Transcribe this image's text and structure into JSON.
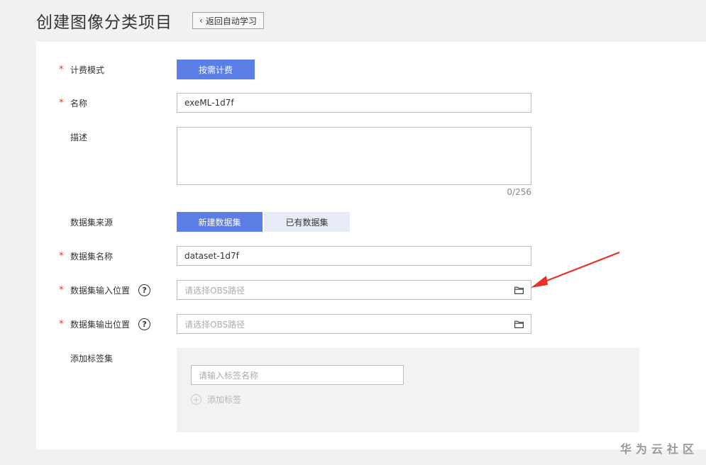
{
  "header": {
    "title": "创建图像分类项目",
    "back_label": "返回自动学习"
  },
  "form": {
    "billing": {
      "label": "计费模式",
      "value": "按需计费"
    },
    "name": {
      "label": "名称",
      "value": "exeML-1d7f"
    },
    "description": {
      "label": "描述",
      "value": "",
      "counter": "0/256"
    },
    "dataset_source": {
      "label": "数据集来源",
      "options": [
        "新建数据集",
        "已有数据集"
      ]
    },
    "dataset_name": {
      "label": "数据集名称",
      "value": "dataset-1d7f"
    },
    "input_location": {
      "label": "数据集输入位置",
      "placeholder": "请选择OBS路径"
    },
    "output_location": {
      "label": "数据集输出位置",
      "placeholder": "请选择OBS路径"
    },
    "tag_set": {
      "label": "添加标签集",
      "input_placeholder": "请输入标签名称",
      "add_label": "添加标签"
    }
  },
  "watermark": "华为云社区",
  "colors": {
    "primary": "#5b7de6",
    "required": "#e5322d",
    "annotation_arrow": "#e8302a"
  },
  "icons": [
    "chevron-left-icon",
    "help-icon",
    "folder-icon",
    "plus-circle-icon",
    "annotation-arrow-icon"
  ]
}
